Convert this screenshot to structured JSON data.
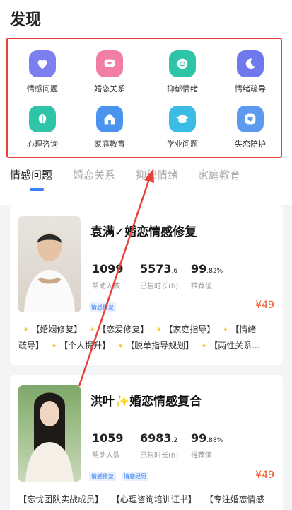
{
  "header": {
    "title": "发现"
  },
  "categories": [
    {
      "label": "情感问题",
      "icon": "heart-icon",
      "color": "#7b7ff0"
    },
    {
      "label": "婚恋关系",
      "icon": "chat-heart-icon",
      "color": "#f27ea7"
    },
    {
      "label": "抑郁情绪",
      "icon": "smile-icon",
      "color": "#2ec4a7"
    },
    {
      "label": "情绪疏导",
      "icon": "moon-icon",
      "color": "#6f78ec"
    },
    {
      "label": "心理咨询",
      "icon": "leaf-icon",
      "color": "#2ec4a7"
    },
    {
      "label": "家庭教育",
      "icon": "home-icon",
      "color": "#4a94ef"
    },
    {
      "label": "学业问题",
      "icon": "graduation-cap-icon",
      "color": "#3bbce6"
    },
    {
      "label": "失恋陪护",
      "icon": "heart-hand-icon",
      "color": "#5c9af0"
    }
  ],
  "tabs": [
    "情感问题",
    "婚恋关系",
    "抑郁情绪",
    "家庭教育"
  ],
  "active_tab": "情感问题",
  "counselors": [
    {
      "name": "袁满✓婚恋情感修复",
      "stats": [
        {
          "value": "1099",
          "suffix": "",
          "label": "帮助人数"
        },
        {
          "value": "5573",
          "suffix": ".6",
          "label": "已售时长(h)"
        },
        {
          "value": "99",
          "suffix": ".82%",
          "label": "推荐值"
        }
      ],
      "badges": [
        "情感修复"
      ],
      "price": "¥49",
      "tags": [
        "【婚姻修复】",
        "【恋爱修复】",
        "【家庭指导】",
        "【情绪",
        "疏导】",
        "【个人提升】",
        "【脱单指导规划】",
        "【两性关系..."
      ]
    },
    {
      "name": "洪叶✨婚恋情感复合",
      "stats": [
        {
          "value": "1059",
          "suffix": "",
          "label": "帮助人数"
        },
        {
          "value": "6983",
          "suffix": ".2",
          "label": "已售时长(h)"
        },
        {
          "value": "99",
          "suffix": ".88%",
          "label": "推荐值"
        }
      ],
      "badges": [
        "情感修复",
        "情感经历"
      ],
      "price": "¥49",
      "tags": [
        "【忘忧团队实战成员】",
        "【心理咨询培训证书】",
        "【专注婚恋情感"
      ]
    }
  ]
}
